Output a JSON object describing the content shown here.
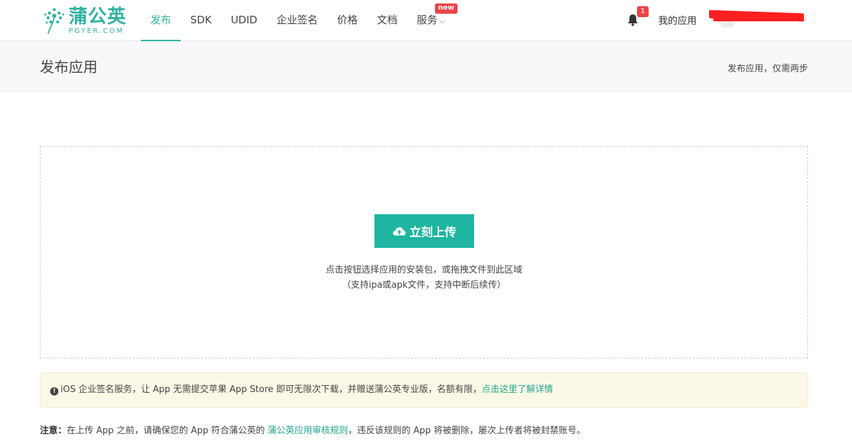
{
  "brand": {
    "name_cn": "蒲公英",
    "name_en": "PGYER.COM",
    "accent": "#32b2a0"
  },
  "nav": {
    "items": [
      {
        "label": "发布",
        "active": true
      },
      {
        "label": "SDK"
      },
      {
        "label": "UDID"
      },
      {
        "label": "企业签名"
      },
      {
        "label": "价格"
      },
      {
        "label": "文档"
      },
      {
        "label": "服务",
        "badge": "new"
      }
    ]
  },
  "header_right": {
    "bell_icon": "bell-icon",
    "notification_count": "1",
    "my_apps": "我的应用",
    "redacted_username": true
  },
  "page": {
    "title": "发布应用",
    "subtitle": "发布应用，仅需两步"
  },
  "upload": {
    "button_icon": "cloud-upload-icon",
    "button_label": "立刻上传",
    "hint_line1": "点击按钮选择应用的安装包，或拖拽文件到此区域",
    "hint_line2": "（支持ipa或apk文件，支持中断后续传）"
  },
  "notice": {
    "icon": "info-circle-icon",
    "text": "iOS 企业签名服务，让 App 无需提交苹果 App Store 即可无限次下载，并赠送蒲公英专业版，名额有限，",
    "link": "点击这里了解详情",
    "bg_color": "#fcf8e7"
  },
  "note": {
    "label": "注意：",
    "text_before": "在上传 App 之前，请确保您的 App 符合蒲公英的 ",
    "link": "蒲公英应用审核规则",
    "text_after": "，违反该规则的 App 将被删除，屡次上传者将被封禁账号。"
  },
  "colors": {
    "primary_button": "#1fb5a0",
    "badge_red": "#e8464b"
  }
}
